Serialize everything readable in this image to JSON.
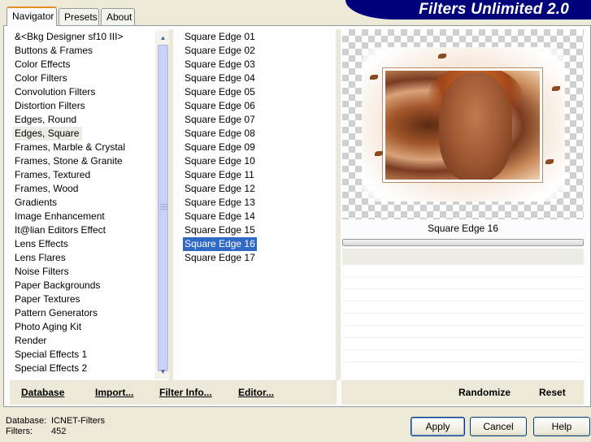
{
  "banner": {
    "title": "Filters Unlimited 2.0"
  },
  "tabs": [
    {
      "label": "Navigator"
    },
    {
      "label": "Presets"
    },
    {
      "label": "About"
    }
  ],
  "categories": {
    "items": [
      "&<Bkg Designer sf10 III>",
      "Buttons & Frames",
      "Color Effects",
      "Color Filters",
      "Convolution Filters",
      "Distortion Filters",
      "Edges, Round",
      "Edges, Square",
      "Frames, Marble & Crystal",
      "Frames, Stone & Granite",
      "Frames, Textured",
      "Frames, Wood",
      "Gradients",
      "Image Enhancement",
      "It@lian Editors Effect",
      "Lens Effects",
      "Lens Flares",
      "Noise Filters",
      "Paper Backgrounds",
      "Paper Textures",
      "Pattern Generators",
      "Photo Aging Kit",
      "Render",
      "Special Effects 1",
      "Special Effects 2"
    ],
    "selected": "Edges, Square"
  },
  "filters": {
    "items": [
      "Square Edge 01",
      "Square Edge 02",
      "Square Edge 03",
      "Square Edge 04",
      "Square Edge 05",
      "Square Edge 06",
      "Square Edge 07",
      "Square Edge 08",
      "Square Edge 09",
      "Square Edge 10",
      "Square Edge 11",
      "Square Edge 12",
      "Square Edge 13",
      "Square Edge 14",
      "Square Edge 15",
      "Square Edge 16",
      "Square Edge 17"
    ],
    "selected": "Square Edge 16"
  },
  "action_bar": {
    "database": "Database",
    "import": "Import...",
    "filter_info": "Filter Info...",
    "editor": "Editor...",
    "randomize": "Randomize",
    "reset": "Reset"
  },
  "preview": {
    "caption": "Square Edge 16",
    "progress": 0
  },
  "status": {
    "database_label": "Database:",
    "database_value": "ICNET-Filters",
    "filters_label": "Filters:",
    "filters_value": "452"
  },
  "buttons": {
    "apply": "Apply",
    "cancel": "Cancel",
    "help": "Help"
  },
  "colors": {
    "banner_bg": "#00007a",
    "selection": "#316ac5",
    "dialog_bg": "#ece9d8"
  },
  "icons": [
    "scroll-up-arrow-icon",
    "scroll-down-arrow-icon",
    "scroll-grip-icon"
  ]
}
